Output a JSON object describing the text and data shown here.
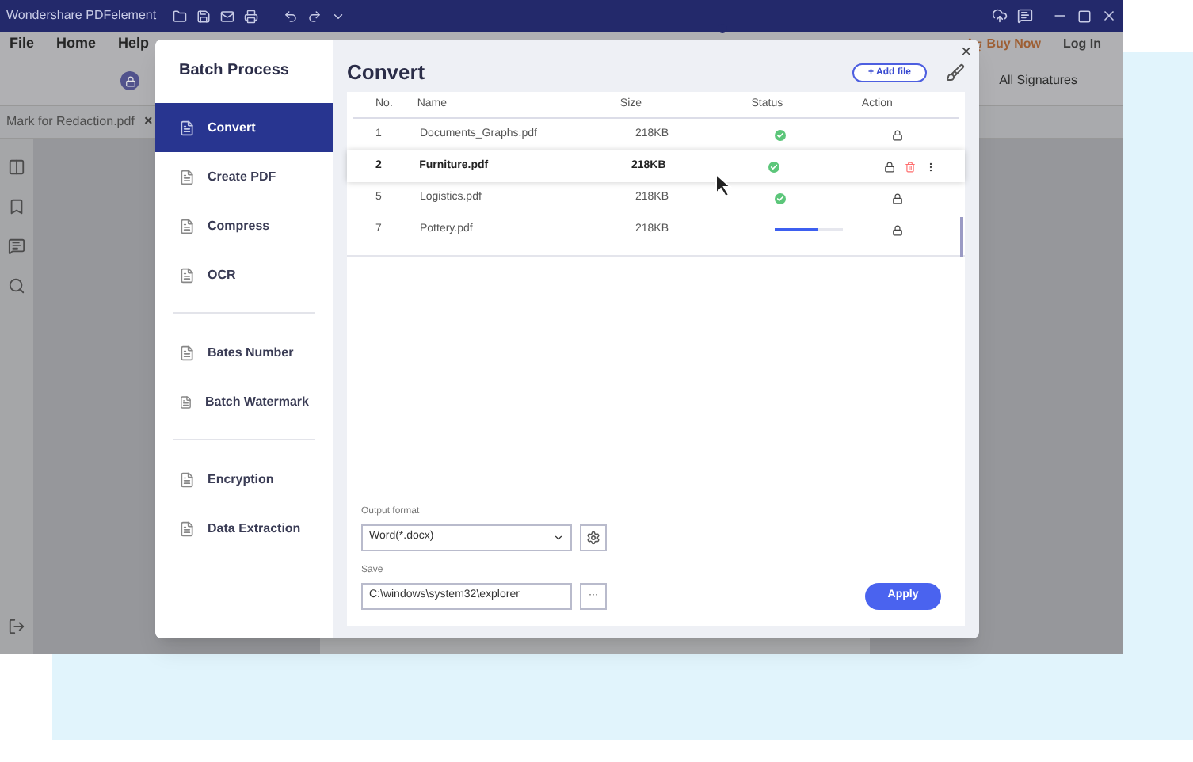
{
  "title_bar": {
    "app_title": "Wondershare PDFelement"
  },
  "menu": [
    "File",
    "Home",
    "Help"
  ],
  "header_actions": {
    "buy": "Buy Now",
    "login": "Log In"
  },
  "toolbar": {
    "signatures": "All Signatures"
  },
  "document_tab": {
    "label": "Mark for Redaction.pdf",
    "close": "×"
  },
  "dialog": {
    "title": "Batch Process",
    "close": "×",
    "sidebar_groups": [
      [
        {
          "label": "Convert",
          "selected": true
        },
        {
          "label": "Create PDF",
          "selected": false
        },
        {
          "label": "Compress",
          "selected": false
        },
        {
          "label": "OCR",
          "selected": false
        }
      ],
      [
        {
          "label": "Bates Number",
          "selected": false
        },
        {
          "label": "Batch Watermark",
          "selected": false
        }
      ],
      [
        {
          "label": "Encryption",
          "selected": false
        },
        {
          "label": "Data Extraction",
          "selected": false
        }
      ]
    ],
    "panel_title": "Convert",
    "add_file": "+ Add file",
    "table": {
      "columns": [
        "No.",
        "Name",
        "Size",
        "Status",
        "Action"
      ],
      "rows": [
        {
          "no": "1",
          "name": "Documents_Graphs.pdf",
          "size": "218KB",
          "status": {
            "kind": "done"
          },
          "selected": false
        },
        {
          "no": "2",
          "name": "Furniture.pdf",
          "size": "218KB",
          "status": {
            "kind": "done"
          },
          "selected": true
        },
        {
          "no": "5",
          "name": "Logistics.pdf",
          "size": "218KB",
          "status": {
            "kind": "done"
          },
          "selected": false
        },
        {
          "no": "7",
          "name": "Pottery.pdf",
          "size": "218KB",
          "status": {
            "kind": "progress",
            "level": 0.62
          },
          "selected": false
        }
      ]
    },
    "output_format": {
      "label": "Output format",
      "value": "Word(*.docx)"
    },
    "save": {
      "label": "Save",
      "value": "C:\\windows\\system32\\explorer",
      "browse": "···"
    },
    "apply": "Apply"
  }
}
